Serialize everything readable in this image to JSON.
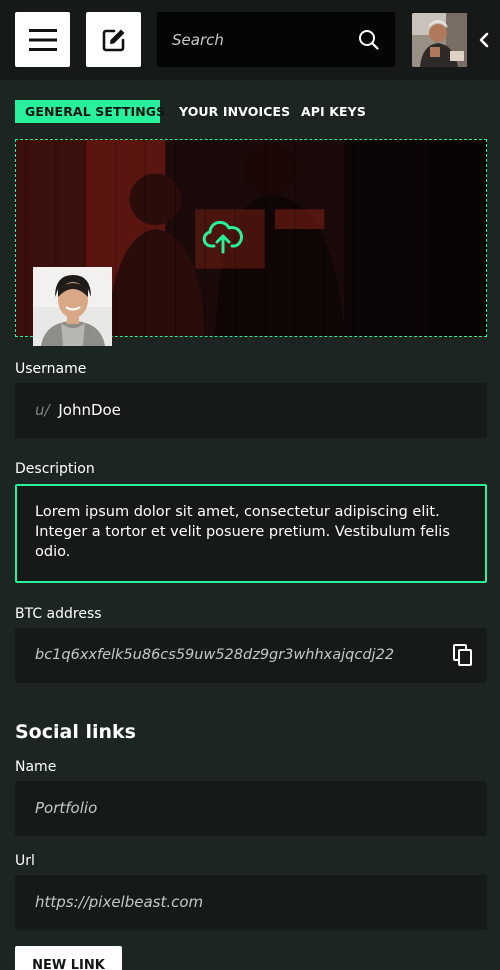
{
  "header": {
    "search_placeholder": "Search"
  },
  "icons": {
    "menu": "hamburger-menu-icon",
    "edit": "edit-icon",
    "search": "search-icon",
    "chevron": "chevron-left-icon",
    "upload": "cloud-upload-icon",
    "copy": "copy-icon"
  },
  "tabs": [
    {
      "label": "GENERAL SETTINGS",
      "active": true
    },
    {
      "label": "YOUR INVOICES",
      "active": false
    },
    {
      "label": "API KEYS",
      "active": false
    }
  ],
  "form": {
    "username_label": "Username",
    "username_prefix": "u/",
    "username_value": "JohnDoe",
    "description_label": "Description",
    "description_value": "Lorem ipsum dolor sit amet, consectetur adipiscing elit. Integer a tortor et velit posuere pretium. Vestibulum felis odio.",
    "btc_label": "BTC address",
    "btc_value": "bc1q6xxfelk5u86cs59uw528dz9gr3whhxajqcdj22"
  },
  "social": {
    "heading": "Social links",
    "name_label": "Name",
    "name_placeholder": "Portfolio",
    "url_label": "Url",
    "url_placeholder": "https://pixelbeast.com",
    "new_link_label": "NEW LINK"
  },
  "colors": {
    "accent": "#28f09b",
    "background": "#1c2522",
    "field": "#151a19",
    "topbar": "#151a19"
  }
}
